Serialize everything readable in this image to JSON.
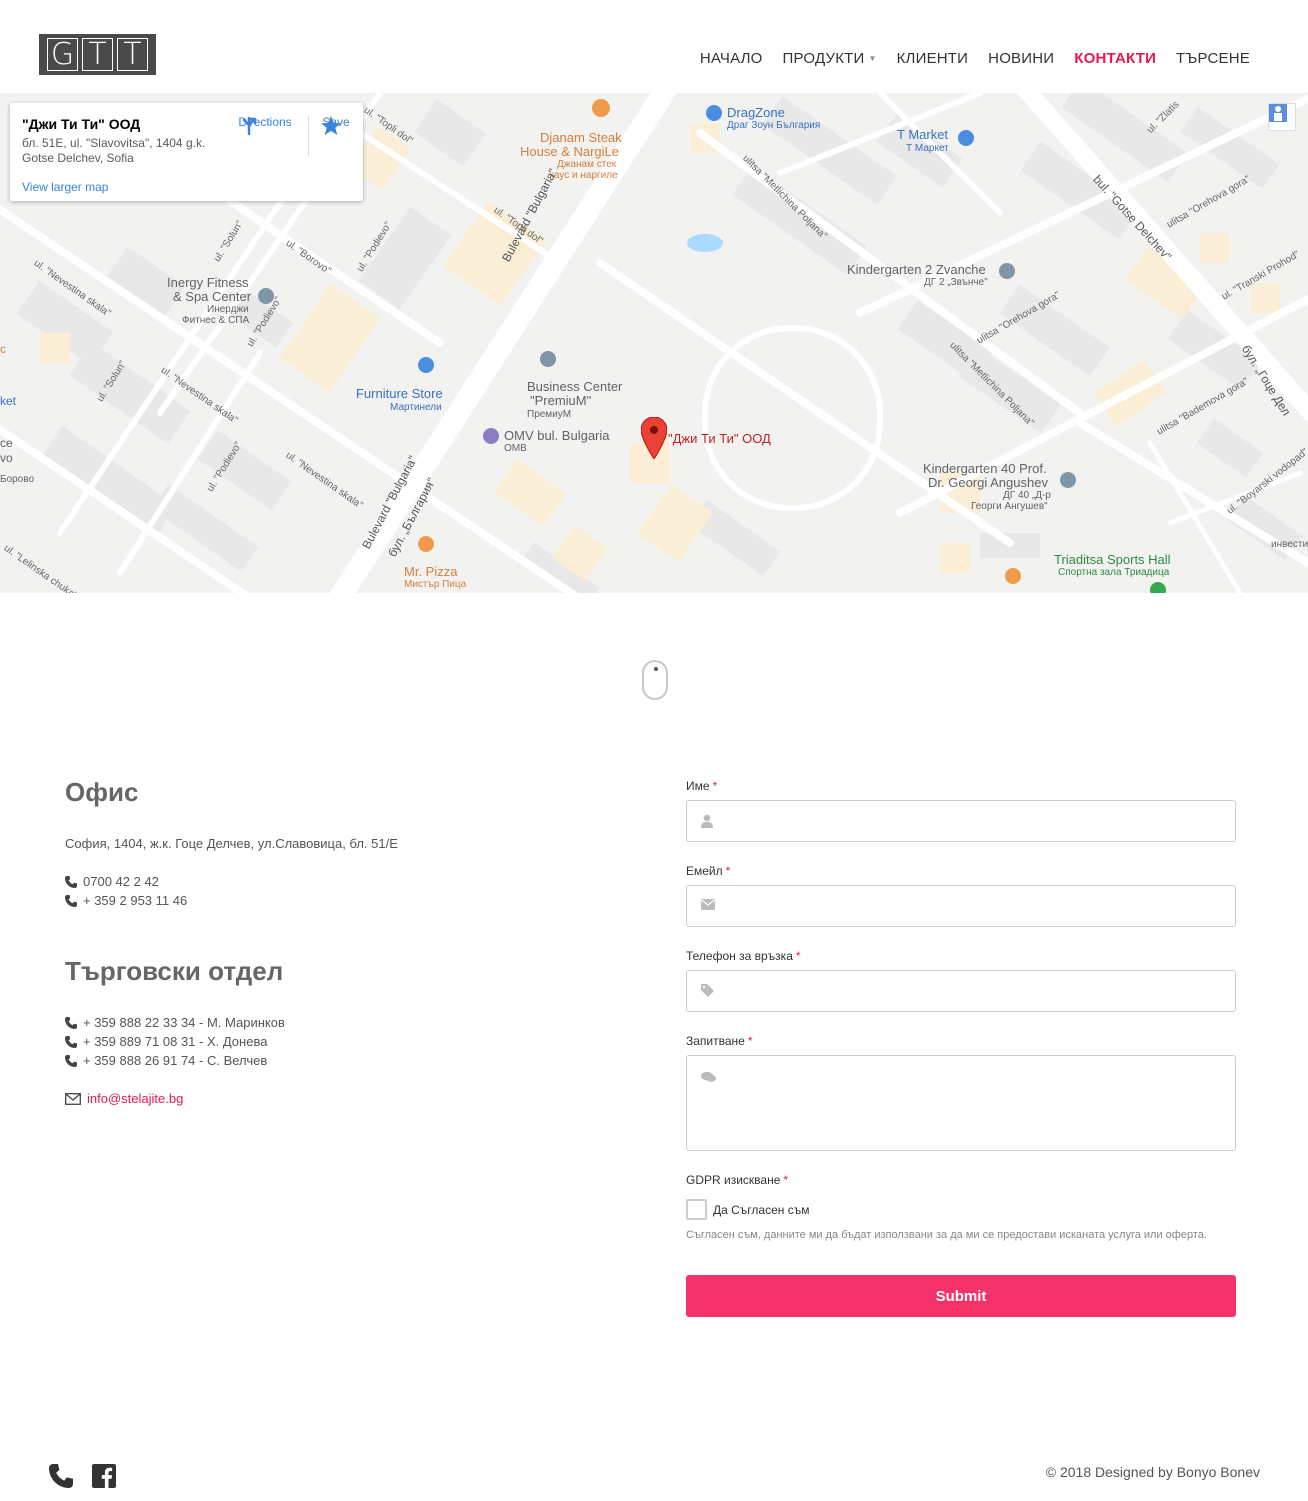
{
  "header": {
    "logo_letters": [
      "G",
      "T",
      "T"
    ],
    "nav": [
      {
        "label": "НАЧАЛО",
        "active": false
      },
      {
        "label": "ПРОДУКТИ",
        "active": false,
        "has_dropdown": true
      },
      {
        "label": "КЛИЕНТИ",
        "active": false
      },
      {
        "label": "НОВИНИ",
        "active": false
      },
      {
        "label": "КОНТАКТИ",
        "active": true
      },
      {
        "label": "ТЪРСЕНЕ",
        "active": false
      }
    ]
  },
  "map": {
    "card": {
      "title": "\"Джи Ти Ти\" ООД",
      "address": "бл. 51E, ul. \"Slavovitsa\", 1404 g.k. Gotse Delchev, Sofia",
      "directions_label": "Directions",
      "save_label": "Save",
      "larger_map_label": "View larger map"
    },
    "pin_label": "\"Джи Ти Ти\" ООД",
    "places": {
      "djanam_1": "Djanam Steak",
      "djanam_2": "House & NargiLe",
      "djanam_3": "Джанам стек",
      "djanam_4": "хаус и наргиле",
      "dragzone_1": "DragZone",
      "dragzone_2": "Драг Зоун България",
      "tmarket_1": "T Market",
      "tmarket_2": "Т Маркет",
      "kg2_1": "Kindergarten 2 Zvanche",
      "kg2_2": "ДГ 2 „Звънче\"",
      "inergy_1": "Inergy Fitness",
      "inergy_2": "& Spa Center",
      "inergy_3": "Инерджи",
      "inergy_4": "Фитнес & СПА",
      "furniture_1": "Furniture Store",
      "furniture_2": "Мартинели",
      "bc_1": "Business Center",
      "bc_2": "\"PremiuM\"",
      "bc_3": "ПремиуМ",
      "omv_1": "OMV bul. Bulgaria",
      "omv_2": "ОМВ",
      "kg40_1": "Kindergarten 40 Prof.",
      "kg40_2": "Dr. Georgi Angushev",
      "kg40_3": "ДГ 40 „Д-р",
      "kg40_4": "Георги Ангушев\"",
      "pizza_1": "Mr. Pizza",
      "pizza_2": "Мистър Пица",
      "sports_1": "Triaditsa Sports Hall",
      "sports_2": "Спортна зала Триадица",
      "left_1": "ket",
      "left_2": "ce",
      "left_3": "vo",
      "left_4": "Борово",
      "left_5": "c",
      "right_1": "инвести"
    },
    "streets": {
      "bulevard_bulgaria": "Bulevard \"Bulgaria\"",
      "bul_bulgaria_bg": "бул. „България\"",
      "gotse_delchev": "bul. \"Gotse Delchev\"",
      "gotse_delchev_bg": "бул. „Гоце Дел",
      "topli_dol_1": "ul. \"Topli dol\"",
      "topli_dol_2": "ul. \"Topli dol\"",
      "metlichina_1": "ulitsa \"Metlichina Poljana\"",
      "metlichina_2": "ulitsa \"Metlichina Poljana\"",
      "orehova_1": "ulitsa \"Orehova gora\"",
      "orehova_2": "ulitsa \"Orehova gora\"",
      "borovo": "ul. \"Borovo\"",
      "podievo_1": "ul. \"Podievo\"",
      "podievo_2": "ul. \"Podievo\"",
      "podievo_3": "ul. \"Podievo\"",
      "solun_1": "ul. \"Solun\"",
      "solun_2": "ul. \"Solun\"",
      "nevestina_1": "ul. \"Nevestina skala\"",
      "nevestina_2": "ul. \"Nevestina skala\"",
      "nevestina_3": "ul. \"Nevestina skala\"",
      "lelinska": "ul. \"Lelinska chuka\"",
      "bademova": "ulitsa \"Bademova gora\"",
      "boyarski": "ul. \"Boyarski vodopad\"",
      "transki": "ul. \"Transki Prohod\"",
      "zlatisi": "ul. \"Zlatis",
      "top_1": "ulitsa \"Zlatis"
    }
  },
  "office": {
    "heading": "Офис",
    "address": "София, 1404, ж.к. Гоце Делчев, ул.Славовица, бл. 51/Е",
    "phones": [
      "0700 42 2 42",
      "+ 359 2 953 11 46"
    ]
  },
  "sales": {
    "heading": "Търговски отдел",
    "phones": [
      "+ 359 888 22 33 34 - М. Маринков",
      "+ 359 889 71 08 31 - Х. Донева",
      "+ 359 888 26 91 74 - С. Велчев"
    ],
    "email": "info@stelajite.bg"
  },
  "form": {
    "name_label": "Име",
    "email_label": "Емейл",
    "phone_label": "Телефон за връзка",
    "inquiry_label": "Запитване",
    "gdpr_label": "GDPR изискване",
    "required_mark": "*",
    "checkbox_label": "Да Съгласен съм",
    "gdpr_note": "Съгласен съм, данните ми да бъдат използвани за да ми се предостави исканата услуга или оферта.",
    "submit_label": "Submit"
  },
  "footer": {
    "copyright": "© 2018 Designed by Bonyo Bonev"
  },
  "colors": {
    "accent": "#e8194f",
    "submit": "#f5316a",
    "map_bg": "#f2f2f0",
    "map_pin": "#ea4335"
  }
}
